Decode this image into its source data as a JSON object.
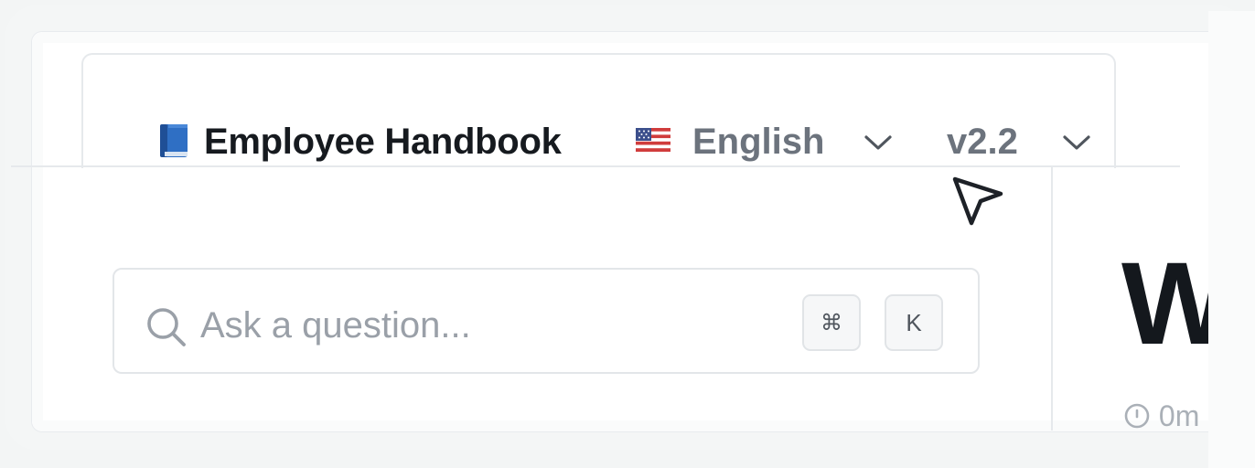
{
  "header": {
    "book_emoji_icon": "blue-book-icon",
    "site_title": "Employee Handbook",
    "language_flag_icon": "us-flag-icon",
    "language": "English",
    "version": "v2.2"
  },
  "search": {
    "placeholder": "Ask a question...",
    "shortcut_modifier": "⌘",
    "shortcut_key": "K"
  },
  "page": {
    "heading_partial": "W",
    "meta_partial": "0m"
  },
  "colors": {
    "title": "#161a1f",
    "muted": "#6c737d",
    "placeholder": "#9aa0a8",
    "border": "#e6e9ec",
    "book_blue": "#2f6fc4"
  }
}
